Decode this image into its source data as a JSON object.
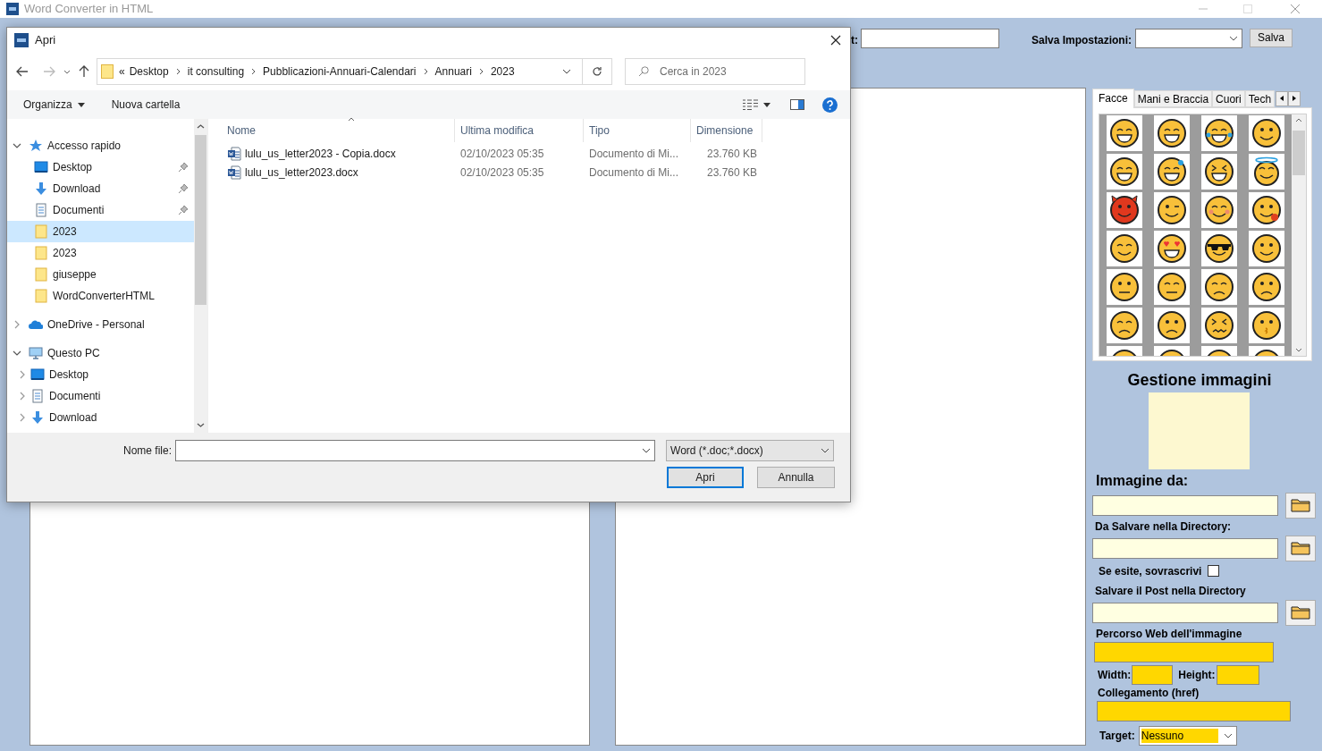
{
  "window": {
    "title": "Word Converter in HTML"
  },
  "toolbar": {
    "partial_label": "t:",
    "save_settings_label": "Salva Impostazioni:",
    "save_button": "Salva"
  },
  "emoji_panel": {
    "tabs": [
      {
        "label": "Facce",
        "selected": true
      },
      {
        "label": "Mani e Braccia",
        "selected": false
      },
      {
        "label": "Cuori",
        "selected": false
      },
      {
        "label": "Tech",
        "selected": false
      }
    ]
  },
  "image_manager": {
    "title": "Gestione immagini",
    "source_label": "Immagine da:",
    "save_dir_label": "Da Salvare nella Directory:",
    "overwrite": {
      "label": "Se esite, sovrascrivi",
      "checked": false
    },
    "post_dir_label": "Salvare il Post nella Directory",
    "web_path_label": "Percorso Web dell'immagine",
    "width_label": "Width:",
    "height_label": "Height:",
    "href_label": "Collegamento (href)",
    "target_label": "Target:",
    "target_value": "Nessuno"
  },
  "dialog": {
    "title": "Apri",
    "breadcrumb": [
      "«",
      "Desktop",
      "it consulting",
      "Pubblicazioni-Annuari-Calendari",
      "Annuari",
      "2023"
    ],
    "search": {
      "placeholder": "Cerca in 2023"
    },
    "commands": [
      "Organizza",
      "Nuova cartella"
    ],
    "tree": [
      {
        "label": "Accesso rapido",
        "kind": "star",
        "expanded": true,
        "selected": false,
        "children": [
          {
            "label": "Desktop",
            "kind": "desktop",
            "pinned": true,
            "selected": false
          },
          {
            "label": "Download",
            "kind": "download",
            "pinned": true,
            "selected": false
          },
          {
            "label": "Documenti",
            "kind": "documents",
            "pinned": true,
            "selected": false
          },
          {
            "label": "2023",
            "kind": "folder",
            "pinned": false,
            "selected": true
          },
          {
            "label": "2023",
            "kind": "folder",
            "pinned": false,
            "selected": false
          },
          {
            "label": "giuseppe",
            "kind": "folder",
            "pinned": false,
            "selected": false
          },
          {
            "label": "WordConverterHTML",
            "kind": "folder",
            "pinned": false,
            "selected": false
          }
        ]
      },
      {
        "label": "OneDrive - Personal",
        "kind": "cloud",
        "expanded": false,
        "selected": false
      },
      {
        "label": "Questo PC",
        "kind": "pc",
        "expanded": true,
        "selected": false,
        "children": [
          {
            "label": "Desktop",
            "kind": "desktop",
            "expanded": false,
            "selected": false
          },
          {
            "label": "Documenti",
            "kind": "documents",
            "expanded": false,
            "selected": false
          },
          {
            "label": "Download",
            "kind": "download",
            "expanded": false,
            "selected": false
          }
        ]
      }
    ],
    "columns": [
      "Nome",
      "Ultima modifica",
      "Tipo",
      "Dimensione"
    ],
    "files": [
      {
        "name": "lulu_us_letter2023 - Copia.docx",
        "modified": "02/10/2023 05:35",
        "type": "Documento di Mi...",
        "size": "23.760 KB"
      },
      {
        "name": "lulu_us_letter2023.docx",
        "modified": "02/10/2023 05:35",
        "type": "Documento di Mi...",
        "size": "23.760 KB"
      }
    ],
    "file_name_label": "Nome file:",
    "filter": "Word (*.doc;*.docx)",
    "buttons": [
      "Apri",
      "Annulla"
    ]
  }
}
